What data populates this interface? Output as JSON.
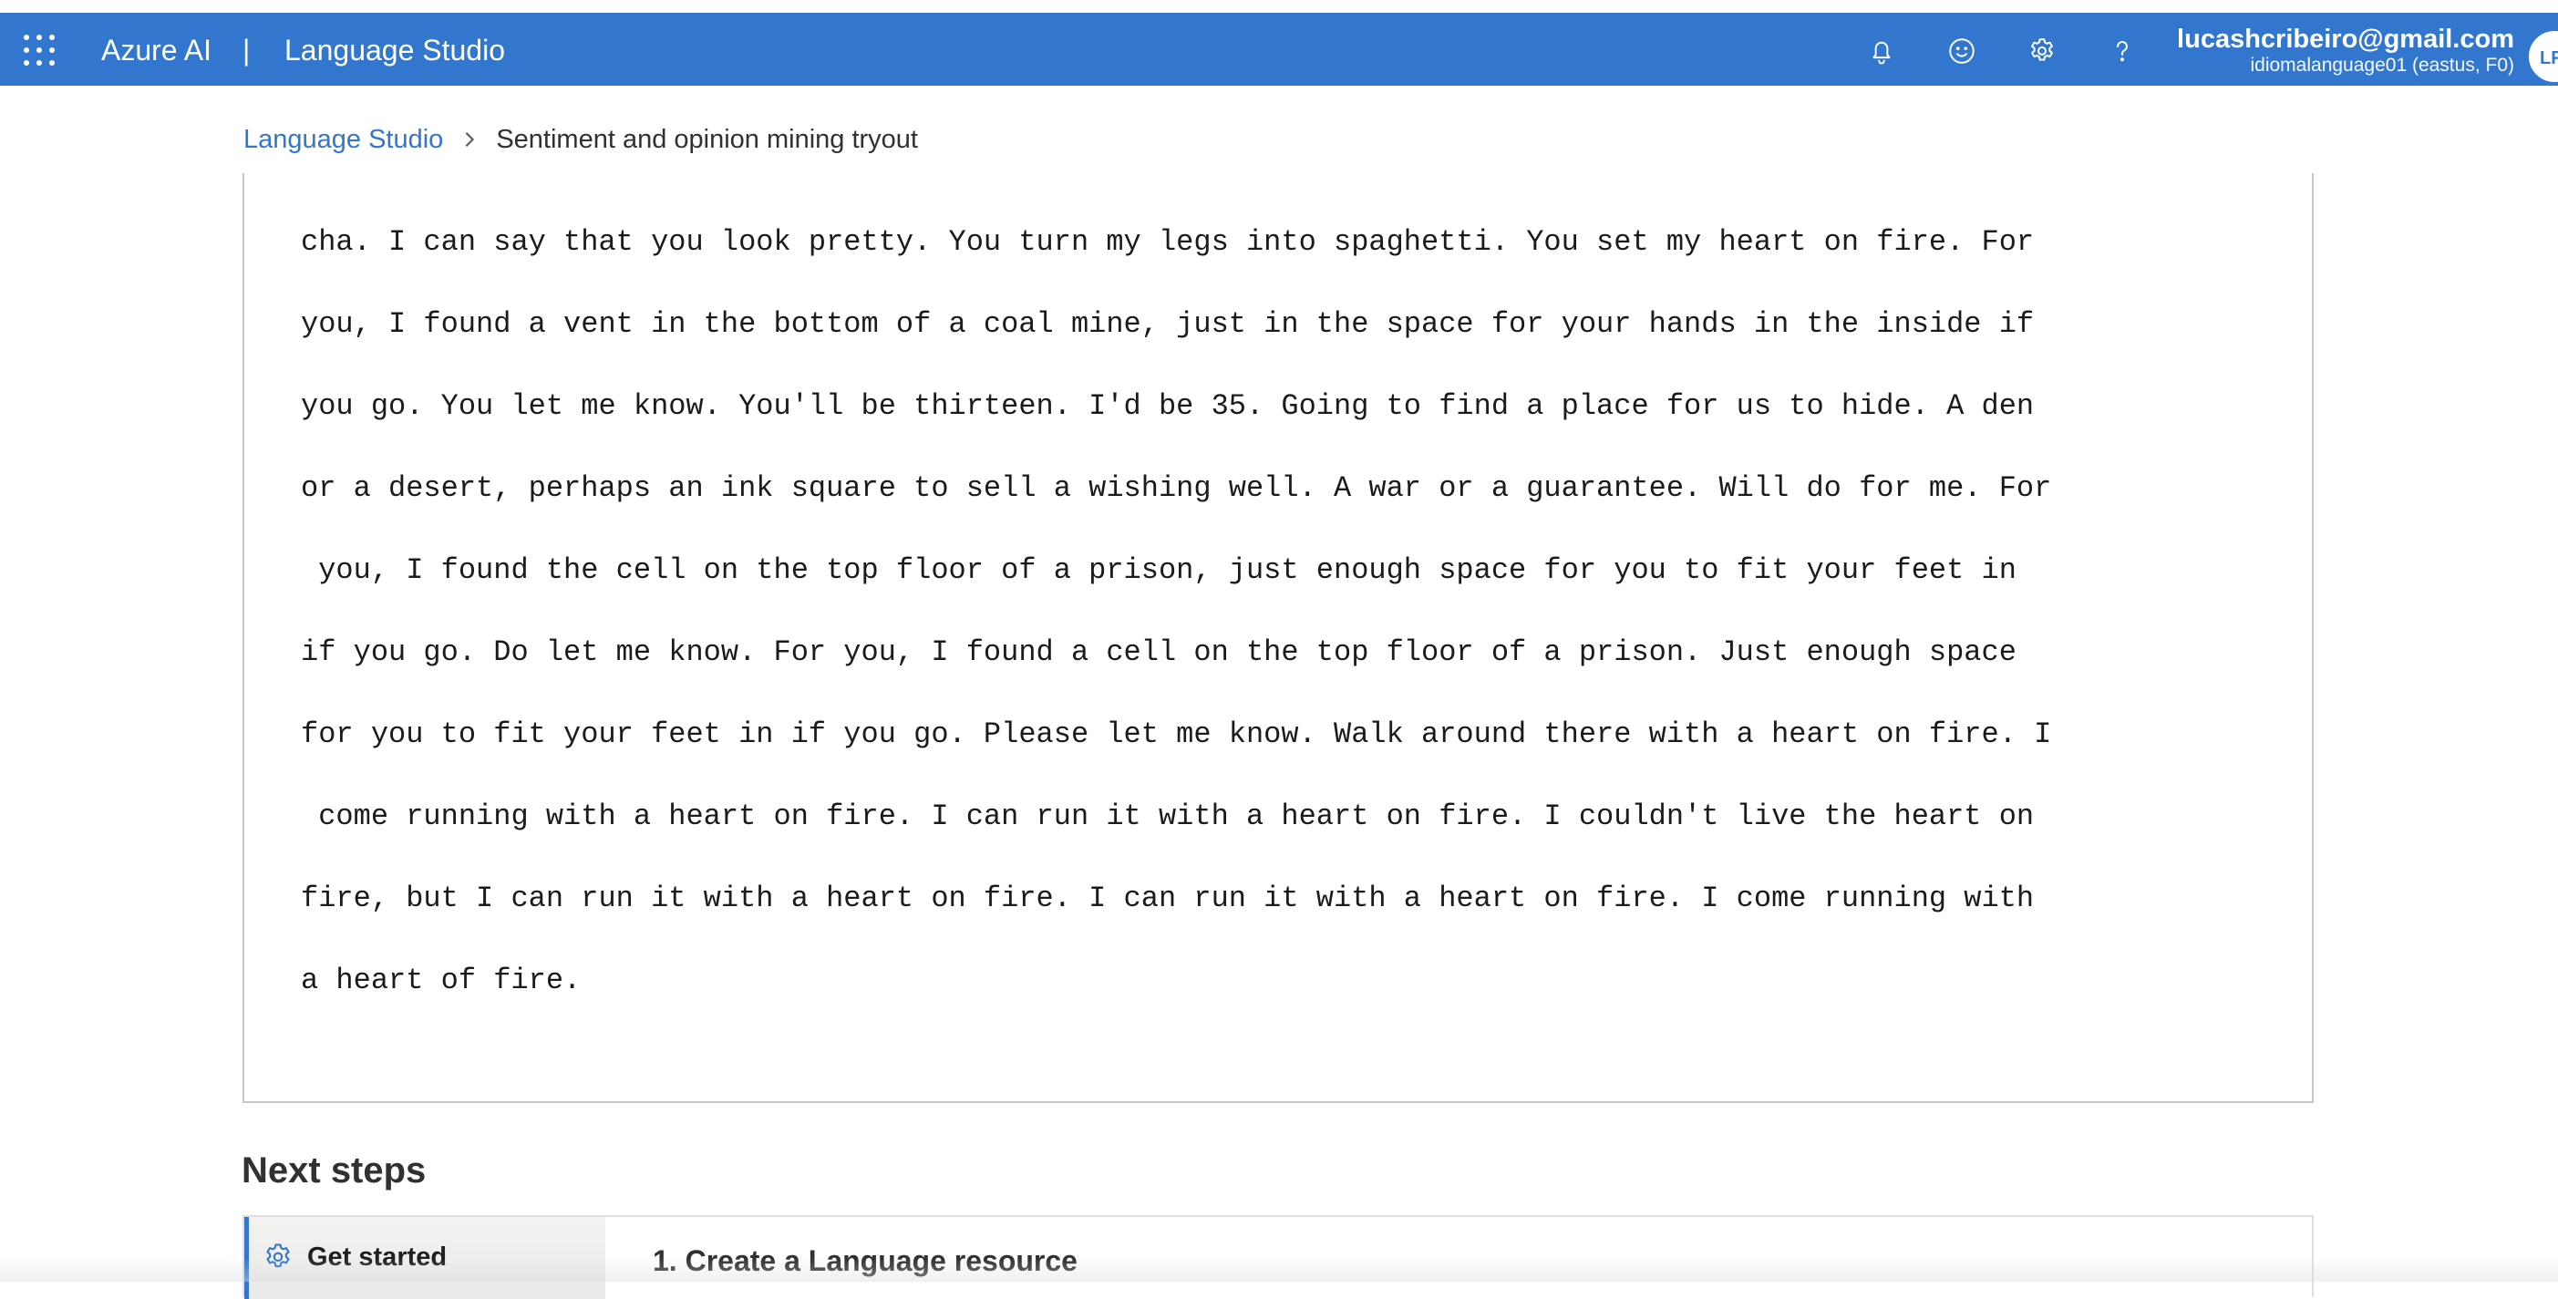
{
  "header": {
    "brand": "Azure AI",
    "separator": "|",
    "product": "Language Studio",
    "account_email": "lucashcribeiro@gmail.com",
    "account_resource": "idiomalanguage01 (eastus, F0)",
    "avatar_initials": "LR",
    "icons": [
      "waffle-icon",
      "bell-icon",
      "smiley-icon",
      "gear-icon",
      "help-icon"
    ],
    "color": "#3277cd"
  },
  "breadcrumb": {
    "home": "Language Studio",
    "current": "Sentiment and opinion mining tryout"
  },
  "input_text": {
    "lines": [
      "cha. I can say that you look pretty. You turn my legs into spaghetti. You set my heart on fire. For",
      "you, I found a vent in the bottom of a coal mine, just in the space for your hands in the inside if",
      "you go. You let me know. You'll be thirteen. I'd be 35. Going to find a place for us to hide. A den",
      "or a desert, perhaps an ink square to sell a wishing well. A war or a guarantee. Will do for me. For",
      " you, I found the cell on the top floor of a prison, just enough space for you to fit your feet in",
      "if you go. Do let me know. For you, I found a cell on the top floor of a prison. Just enough space",
      "for you to fit your feet in if you go. Please let me know. Walk around there with a heart on fire. I",
      " come running with a heart on fire. I can run it with a heart on fire. I couldn't live the heart on",
      "fire, but I can run it with a heart on fire. I can run it with a heart on fire. I come running with",
      "a heart of fire."
    ]
  },
  "next_steps": {
    "heading": "Next steps",
    "nav_label": "Get started",
    "step_title": "1. Create a Language resource"
  }
}
